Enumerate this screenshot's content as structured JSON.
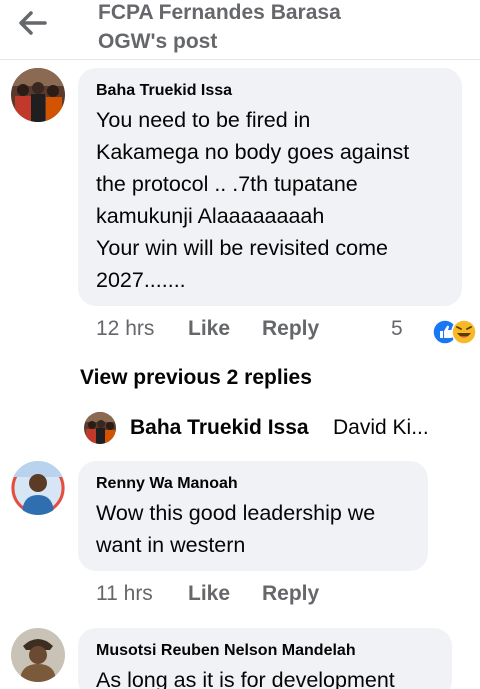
{
  "header": {
    "title_line1": "FCPA Fernandes Barasa",
    "title_line2": "OGW's post"
  },
  "comments": [
    {
      "author": "Baha Truekid Issa",
      "lines": [
        "You need to be fired in",
        "Kakamega no body goes against",
        "the protocol .. .7th tupatane",
        "kamukunji Alaaaaaaaah",
        "Your win will be revisited come",
        "2027......."
      ],
      "time": "12 hrs",
      "like_label": "Like",
      "reply_label": "Reply",
      "reaction_count": "5",
      "reaction_icons": [
        "like-reaction-icon",
        "haha-reaction-icon"
      ]
    },
    {
      "author": "Renny Wa Manoah",
      "lines": [
        "Wow this good leadership we",
        "want in western"
      ],
      "time": "11 hrs",
      "like_label": "Like",
      "reply_label": "Reply"
    },
    {
      "author": "Musotsi Reuben Nelson Mandelah",
      "lines": [
        "As long as it is for development"
      ]
    }
  ],
  "view_previous": "View previous 2 replies",
  "reply_preview": {
    "name": "Baha Truekid Issa",
    "snippet": "David Ki..."
  },
  "colors": {
    "bubble": "#f0f2f5",
    "secondary_text": "#65676b",
    "like_blue": "#1877f2",
    "haha_yellow": "#f7b928"
  }
}
